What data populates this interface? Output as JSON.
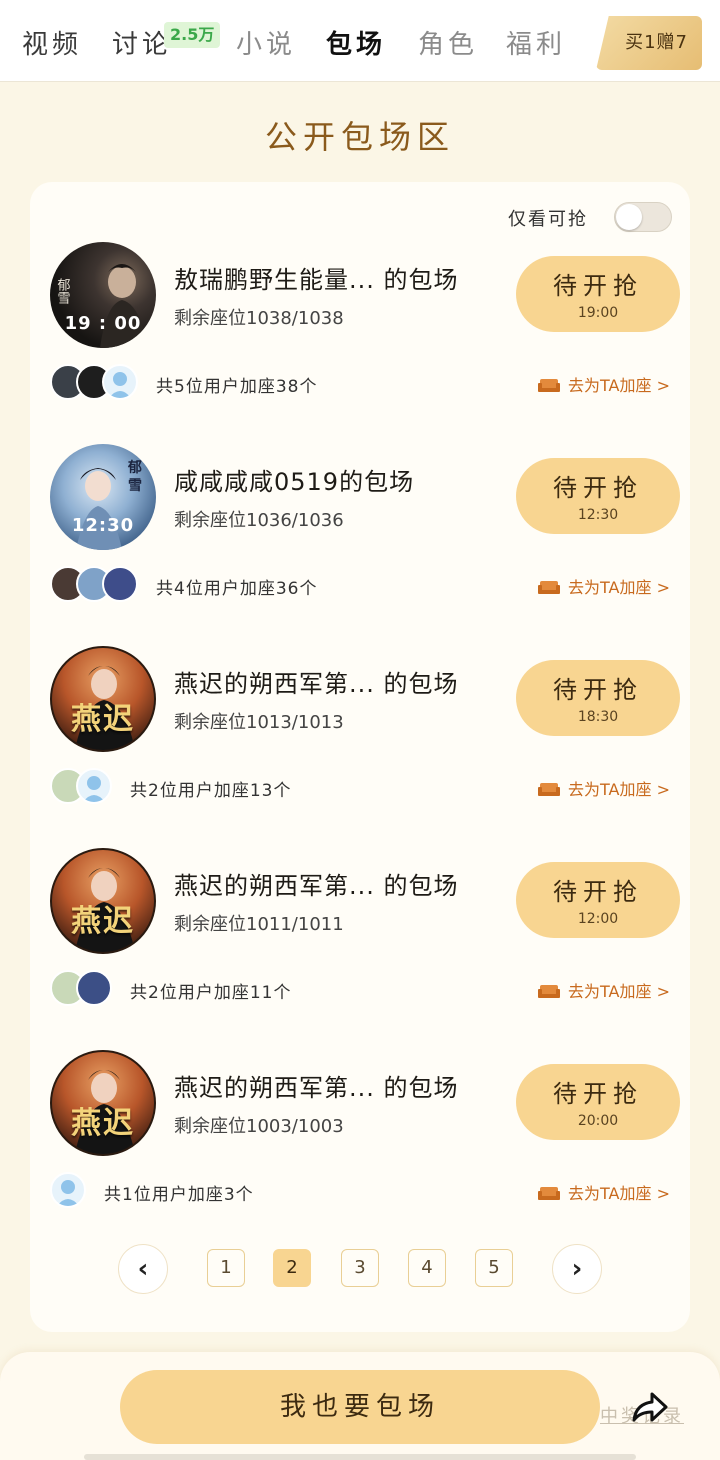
{
  "tabs": [
    {
      "label": "视频",
      "state": "normal"
    },
    {
      "label": "讨论",
      "state": "normal",
      "badge": "2.5万"
    },
    {
      "label": "小说",
      "state": "muted"
    },
    {
      "label": "包场",
      "state": "active"
    },
    {
      "label": "角色",
      "state": "muted"
    },
    {
      "label": "福利",
      "state": "muted"
    }
  ],
  "promo": {
    "label": "买1赠7"
  },
  "section_title": "公开包场区",
  "filter": {
    "label": "仅看可抢",
    "on": false
  },
  "items": [
    {
      "title": "敖瑞鹏野生能量... 的包场",
      "seats": "剩余座位1038/1038",
      "button_label": "待开抢",
      "button_time": "19:00",
      "cover_time": "19 : 00",
      "cover_corner": "",
      "cover_glyph": "",
      "joined_text": "共5位用户加座38个",
      "add_seat": "去为TA加座 >",
      "avatar_count": 3
    },
    {
      "title": "咸咸咸咸0519的包场",
      "seats": "剩余座位1036/1036",
      "button_label": "待开抢",
      "button_time": "12:30",
      "cover_time": "12:30",
      "cover_corner": "",
      "cover_glyph": "",
      "joined_text": "共4位用户加座36个",
      "add_seat": "去为TA加座 >",
      "avatar_count": 3
    },
    {
      "title": "燕迟的朔西军第... 的包场",
      "seats": "剩余座位1013/1013",
      "button_label": "待开抢",
      "button_time": "18:30",
      "cover_time": "",
      "cover_corner": "",
      "cover_glyph": "燕迟",
      "joined_text": "共2位用户加座13个",
      "add_seat": "去为TA加座 >",
      "avatar_count": 2
    },
    {
      "title": "燕迟的朔西军第... 的包场",
      "seats": "剩余座位1011/1011",
      "button_label": "待开抢",
      "button_time": "12:00",
      "cover_time": "",
      "cover_corner": "",
      "cover_glyph": "燕迟",
      "joined_text": "共2位用户加座11个",
      "add_seat": "去为TA加座 >",
      "avatar_count": 2
    },
    {
      "title": "燕迟的朔西军第... 的包场",
      "seats": "剩余座位1003/1003",
      "button_label": "待开抢",
      "button_time": "20:00",
      "cover_time": "",
      "cover_corner": "",
      "cover_glyph": "燕迟",
      "joined_text": "共1位用户加座3个",
      "add_seat": "去为TA加座 >",
      "avatar_count": 1
    }
  ],
  "pagination": {
    "prev_icon": "chevron-left-icon",
    "next_icon": "chevron-right-icon",
    "pages": [
      "1",
      "2",
      "3",
      "4",
      "5"
    ],
    "current": "2"
  },
  "bottom": {
    "main_button": "我也要包场",
    "record_link": "中奖记录",
    "share_icon": "share-icon"
  },
  "colors": {
    "accent": "#f8d591",
    "title": "#8a5a1c",
    "link": "#c86a1e",
    "background": "#fbf6e6"
  }
}
